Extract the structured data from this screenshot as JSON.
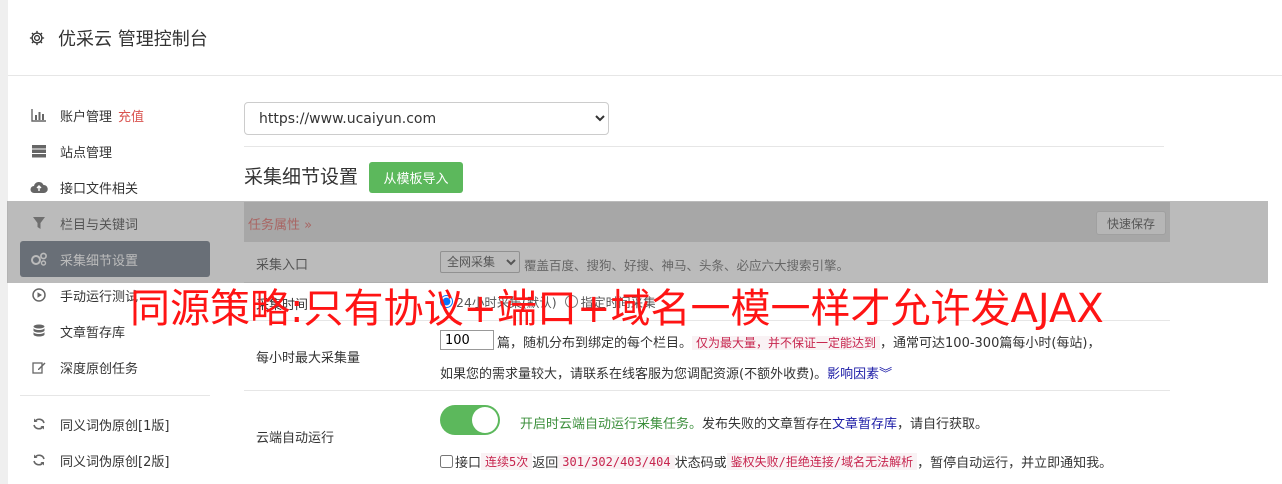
{
  "header": {
    "title": "优采云 管理控制台",
    "icon": "gear-icon"
  },
  "sidebar": {
    "items": [
      {
        "label": "账户管理",
        "extra": "充值",
        "icon": "bar-chart-icon"
      },
      {
        "label": "站点管理",
        "icon": "server-icon"
      },
      {
        "label": "接口文件相关",
        "icon": "cloud-upload-icon"
      },
      {
        "label": "栏目与关键词",
        "icon": "filter-icon"
      },
      {
        "label": "采集细节设置",
        "icon": "cogs-icon",
        "active": true
      },
      {
        "label": "手动运行测试",
        "icon": "play-circle-icon"
      },
      {
        "label": "文章暂存库",
        "icon": "database-icon"
      },
      {
        "label": "深度原创任务",
        "icon": "edit-icon"
      },
      {
        "label": "同义词伪原创[1版]",
        "icon": "refresh-icon"
      },
      {
        "label": "同义词伪原创[2版]",
        "icon": "refresh-icon"
      }
    ]
  },
  "main": {
    "site_select": {
      "value": "https://www.ucaiyun.com"
    },
    "section_title": "采集细节设置",
    "import_button": "从模板导入",
    "panel": {
      "task_attr": "任务属性",
      "quick_save": "快速保存"
    },
    "entry": {
      "label": "采集入口",
      "select_value": "全网采集",
      "desc": "覆盖百度、搜狗、好搜、神马、头条、必应六大搜索引擎。"
    },
    "time": {
      "label": "采集时间",
      "opt1": "24小时采集(默认)",
      "opt2": "指定时间采集"
    },
    "max": {
      "label": "每小时最大采集量",
      "value": "100",
      "text_a": "篇，随机分布到绑定的每个栏目。",
      "hl": "仅为最大量，并不保证一定能达到",
      "text_b": "，通常可达100-300篇每小时(每站)，",
      "line2": "如果您的需求量较大，请联系在线客服为您调配资源(不额外收费)。",
      "link": "影响因素"
    },
    "cloud": {
      "label": "云端自动运行",
      "text_green": "开启时云端自动运行采集任务。",
      "text_a": "发布失败的文章暂存在",
      "link": "文章暂存库",
      "text_b": "，请自行获取。",
      "api_a": "接口",
      "hl1": "连续5次",
      "api_b": "返回",
      "hl2": "301/302/403/404",
      "api_c": "状态码或",
      "hl3": "鉴权失败/拒绝连接/域名无法解析",
      "api_d": "，暂停自动运行，并立即通知我。"
    }
  },
  "banner": "同源策略:只有协议+端口+域名一模一样才允许发AJAX",
  "colors": {
    "accent_green": "#5cb85c",
    "danger": "#d9534f",
    "active_bg": "#5a6776",
    "banner_red": "#ff1414"
  }
}
